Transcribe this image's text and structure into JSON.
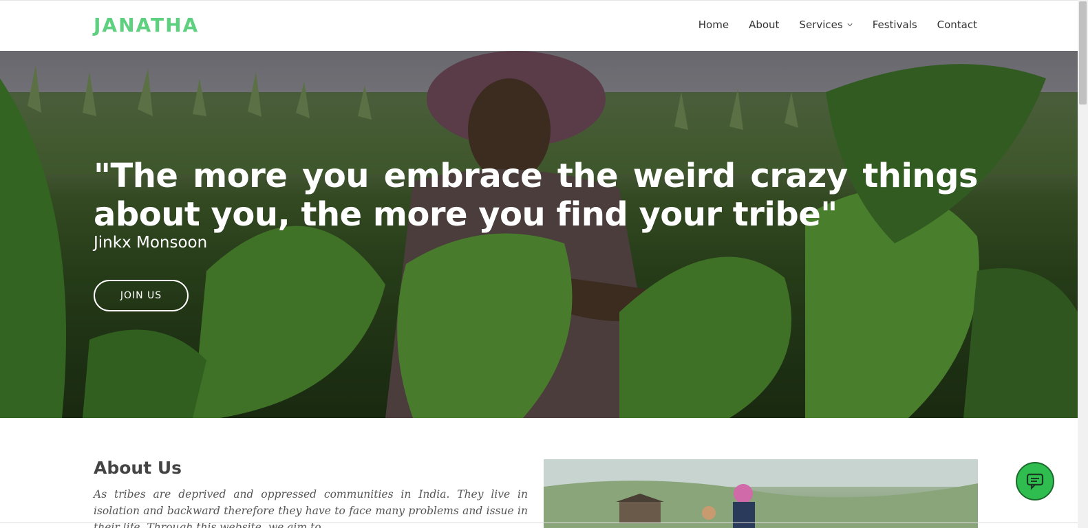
{
  "header": {
    "logo": "JANATHA",
    "nav": [
      {
        "label": "Home"
      },
      {
        "label": "About"
      },
      {
        "label": "Services",
        "has_dropdown": true
      },
      {
        "label": "Festivals"
      },
      {
        "label": "Contact"
      }
    ]
  },
  "hero": {
    "quote": "\"The more you embrace the weird crazy things about you, the more you find your tribe\"",
    "author": "Jinkx Monsoon",
    "cta": "JOIN US"
  },
  "about": {
    "title": "About Us",
    "text": "As tribes are deprived and oppressed communities in India. They live in isolation and backward therefore they have to face many problems and issue in their life. Through this website, we aim to..."
  },
  "icons": {
    "chat": "chat-icon",
    "dropdown": "chevron-down-icon"
  },
  "colors": {
    "brand": "#5fcf80",
    "chat_button": "#2ebd4e"
  }
}
